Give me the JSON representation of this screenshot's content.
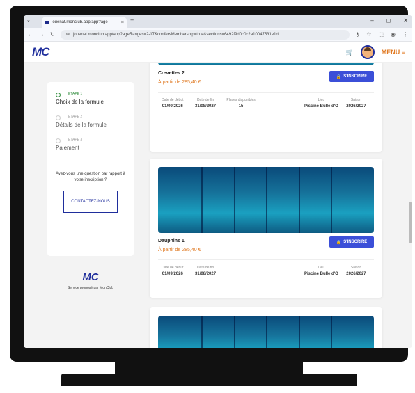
{
  "browser": {
    "tab_title": "jouenat.monclub.app/app?age",
    "new_tab": "+",
    "url": "jouenat.monclub.app/app?ageRanges=2-17&confersMembership=true&sections=6492f9d0c0c2a10047531e1d",
    "minimize": "–",
    "maximize": "◻",
    "close": "✕"
  },
  "header": {
    "logo": "MC",
    "menu_label": "MENU"
  },
  "stepper": {
    "steps": [
      {
        "label": "ETAPE 1",
        "name": "Choix de la formule"
      },
      {
        "label": "ETAPE 2",
        "name": "Détails de la formule"
      },
      {
        "label": "ETAPE 3",
        "name": "Paiement"
      }
    ],
    "help_text": "Avez-vous une question par rapport à votre inscription ?",
    "contact_button": "CONTACTEZ-NOUS"
  },
  "footer_brand": {
    "logo": "MC",
    "text": "Service proposé par MonClub"
  },
  "cards": [
    {
      "title": "Crevettes 2",
      "price": "À partir de 285,40 €",
      "button": "S'INSCRIRE",
      "start_label": "Date de début",
      "start_value": "01/09/2026",
      "end_label": "Date de fin",
      "end_value": "31/08/2027",
      "places_label": "Places disponibles",
      "places_value": "15",
      "lieu_label": "Lieu",
      "lieu_value": "Piscine Bulle d'O",
      "saison_label": "Saison",
      "saison_value": "2026/2027"
    },
    {
      "title": "Dauphins 1",
      "price": "À partir de 285,40 €",
      "button": "S'INSCRIRE",
      "start_label": "Date de début",
      "start_value": "01/09/2026",
      "end_label": "Date de fin",
      "end_value": "31/08/2027",
      "lieu_label": "Lieu",
      "lieu_value": "Piscine Bulle d'O",
      "saison_label": "Saison",
      "saison_value": "2026/2027"
    }
  ]
}
